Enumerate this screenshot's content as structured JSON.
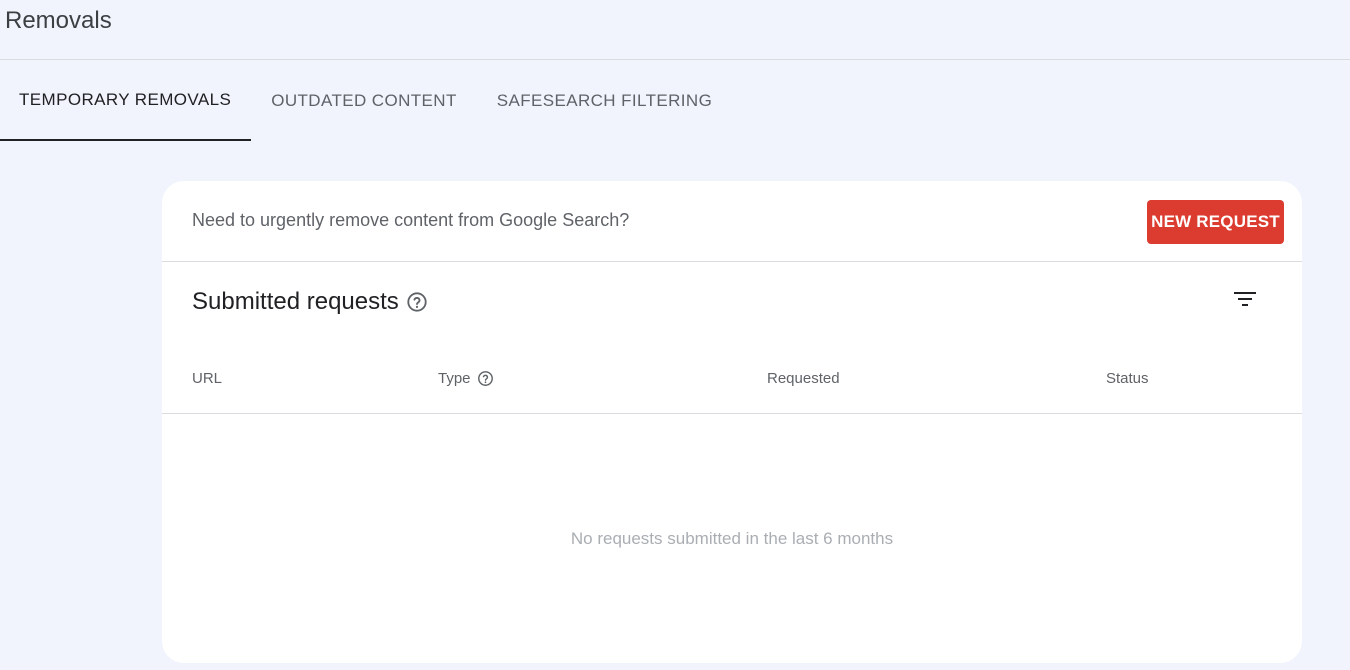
{
  "page": {
    "title": "Removals"
  },
  "tabs": [
    {
      "label": "TEMPORARY REMOVALS",
      "active": true
    },
    {
      "label": "OUTDATED CONTENT",
      "active": false
    },
    {
      "label": "SAFESEARCH FILTERING",
      "active": false
    }
  ],
  "banner": {
    "text": "Need to urgently remove content from Google Search?",
    "button_label": "NEW REQUEST"
  },
  "requests": {
    "title": "Submitted requests",
    "columns": [
      "URL",
      "Type",
      "Requested",
      "Status"
    ],
    "empty_message": "No requests submitted in the last 6 months"
  },
  "icons": {
    "help": "help-circle-icon",
    "filter": "filter-icon"
  },
  "colors": {
    "background": "#f1f4fc",
    "primary_button": "#dc3b2f",
    "active_tab_underline": "#202124"
  }
}
